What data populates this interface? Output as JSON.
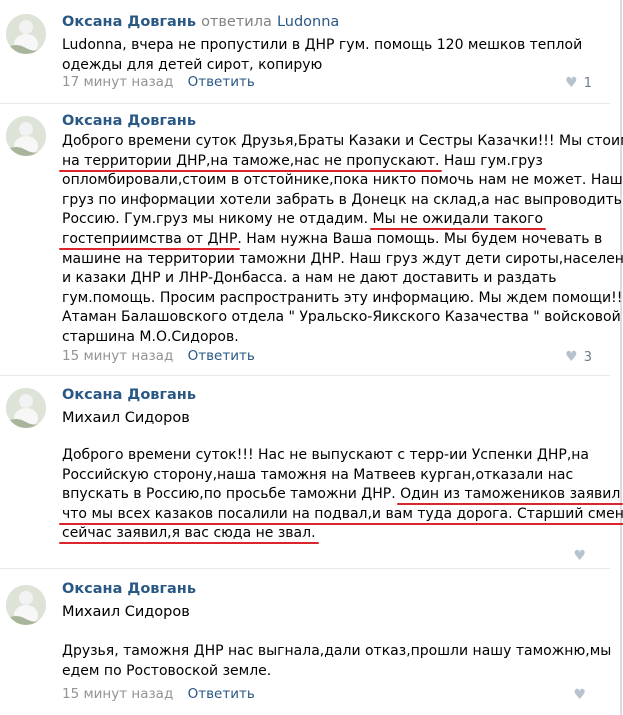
{
  "comments": [
    {
      "author": "Оксана Довгань",
      "verb": "ответила",
      "target": "Ludonna",
      "lines": [
        "Ludonna, вчера не пропустили в ДНР гум. помощь 120 мешков теплой",
        "одежды для детей сирот, копирую"
      ],
      "time": "17 минут назад",
      "reply": "Ответить",
      "likes": "1"
    },
    {
      "author": "Оксана Довгань",
      "l1": "Доброго времени суток Друзья,Браты Казаки и Сестры Казачки!!! Мы стоим",
      "l2u": "на территории ДНР,на таможе,нас не пропускают.",
      "l2b": " Наш гум.груз",
      "l3": "опломбировали,стоим в отстойнике,пока никто помочь нам не может. Наш",
      "l4": "груз по информации хотели забрать в Донецк на склад,а нас выпроводить в",
      "l5a": "Россию. Гум.груз мы никому не отдадим. ",
      "l5u": "Мы не ожидали такого",
      "l6u": "гостеприимства от ДНР",
      "l6b": ". Нам нужна Ваша помощь. Мы будем ночевать в",
      "l7": "машине на территории таможни ДНР. Наш груз ждут дети сироты,население",
      "l8": "и казаки ДНР и ЛНР-Донбасса. а нам не дают доставить и раздать",
      "l9": "гум.помощь. Просим распространить эту информацию. Мы ждем помощи!!!",
      "l10": "Атаман Балашовского отдела \" Уральско-Яикского Казачества \" войсковой",
      "l11": "старшина М.О.Сидоров.",
      "time": "15 минут назад",
      "reply": "Ответить",
      "likes": "3"
    },
    {
      "author": "Оксана Довгань",
      "addressee": "Михаил Сидоров",
      "l1": "Доброго времени суток!!! Нас не выпускают с терр-ии Успенки ДНР,на",
      "l2": "Российскую сторону,наша таможня на Матвеев курган,отказали нас",
      "l3a": "впускать в Россию,по просьбе таможни ДНР. ",
      "l3u": "Один из таможеников заявил",
      "l4u": "что мы всех казаков посалили на подвал,и вам туда дорога. Старший смены",
      "l5u": "сейчас заявил,я вас сюда не звал."
    },
    {
      "author": "Оксана Довгань",
      "addressee": "Михаил Сидоров",
      "lines": [
        "Друзья, таможня ДНР нас выгнала,дали отказ,прошли нашу таможню,мы",
        "едем по Ростовоской земле."
      ],
      "time": "15 минут назад",
      "reply": "Ответить"
    }
  ]
}
